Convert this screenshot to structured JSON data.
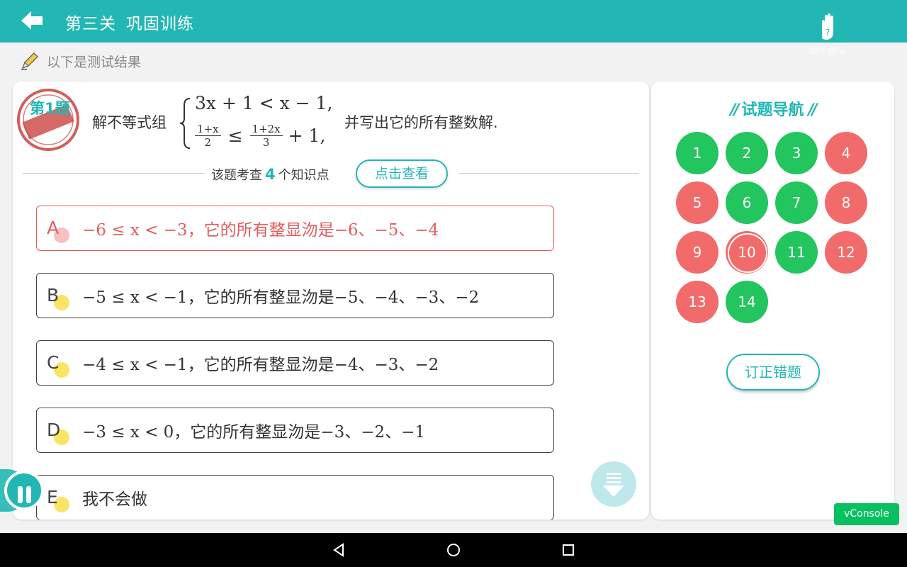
{
  "header": {
    "title": "第三关",
    "subtitle": "巩固训练",
    "raise_hand_label": "举手提问",
    "bg_color": "#22b7b4"
  },
  "subheader": {
    "text": "以下是测试结果"
  },
  "question": {
    "stamp_label": "第1题",
    "intro": "解不等式组",
    "system_line1": "3x + 1 < x − 1,",
    "frac1_num": "1+x",
    "frac1_den": "2",
    "leq": "≤",
    "frac2_num": "1+2x",
    "frac2_den": "3",
    "system_line2_tail": "+ 1,",
    "tail": "并写出它的所有整数解."
  },
  "knowledge": {
    "prefix": "该题考查",
    "count": "4",
    "suffix": "个知识点",
    "button_label": "点击查看"
  },
  "options": [
    {
      "letter": "A",
      "text": "−6 ≤ x < −3，它的所有整显沕是−6、−5、−4",
      "status": "wrong"
    },
    {
      "letter": "B",
      "text": "−5 ≤ x < −1，它的所有整显沕是−5、−4、−3、−2",
      "status": "normal"
    },
    {
      "letter": "C",
      "text": "−4 ≤ x < −1，它的所有整显沕是−4、−3、−2",
      "status": "normal"
    },
    {
      "letter": "D",
      "text": "−3 ≤ x < 0，它的所有整显沕是−3、−2、−1",
      "status": "normal"
    },
    {
      "letter": "E",
      "text": "我不会做",
      "status": "normal"
    }
  ],
  "navigator": {
    "title": "试题导航",
    "deco": "//",
    "items": [
      {
        "n": "1",
        "status": "correct"
      },
      {
        "n": "2",
        "status": "correct"
      },
      {
        "n": "3",
        "status": "correct"
      },
      {
        "n": "4",
        "status": "wrong"
      },
      {
        "n": "5",
        "status": "wrong"
      },
      {
        "n": "6",
        "status": "correct"
      },
      {
        "n": "7",
        "status": "correct"
      },
      {
        "n": "8",
        "status": "wrong"
      },
      {
        "n": "9",
        "status": "wrong"
      },
      {
        "n": "10",
        "status": "wrong",
        "current": true
      },
      {
        "n": "11",
        "status": "correct"
      },
      {
        "n": "12",
        "status": "wrong"
      },
      {
        "n": "13",
        "status": "wrong"
      },
      {
        "n": "14",
        "status": "correct"
      }
    ],
    "fix_button_label": "订正错题",
    "correct_color": "#22c55e",
    "wrong_color": "#f26b6b"
  },
  "vconsole_label": "vConsole",
  "icons": {
    "back": "back-arrow-icon",
    "hand": "raise-hand-icon",
    "pencil": "pencil-icon",
    "stamp": "wrong-stamp-icon",
    "scroll": "scroll-down-icon",
    "pause": "pause-icon",
    "nav_back": "nav-back-icon",
    "nav_home": "nav-home-icon",
    "nav_recent": "nav-recent-icon"
  }
}
